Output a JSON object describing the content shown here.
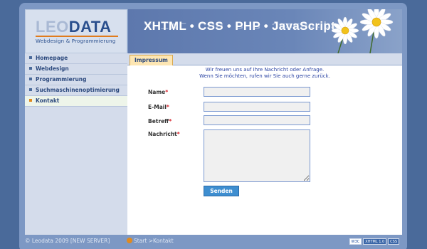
{
  "logo": {
    "leo": "LEO",
    "data": "DATA",
    "subtitle": "Webdesign & Programmierung"
  },
  "banner": {
    "title": "XHTML • CSS • PHP • JavaScript"
  },
  "sidebar": {
    "items": [
      {
        "label": "Homepage",
        "active": false
      },
      {
        "label": "Webdesign",
        "active": false
      },
      {
        "label": "Programmierung",
        "active": false
      },
      {
        "label": "Suchmaschinenoptimierung",
        "active": false
      },
      {
        "label": "Kontakt",
        "active": true
      }
    ]
  },
  "content": {
    "tab": "Impressum",
    "intro_line1": "Wir freuen uns auf Ihre Nachricht oder Anfrage.",
    "intro_line2": "Wenn Sie möchten, rufen wir Sie auch gerne zurück.",
    "form": {
      "name_label": "Name",
      "email_label": "E-Mail",
      "subject_label": "Betreff",
      "message_label": "Nachricht",
      "required_mark": "*",
      "name_value": "",
      "email_value": "",
      "subject_value": "",
      "message_value": "",
      "submit_label": "Senden"
    }
  },
  "footer": {
    "copyright": "© Leodata 2009 [NEW SERVER]",
    "breadcrumb": "Start >Kontakt",
    "badges": [
      "W3C",
      "XHTML 1.0",
      "CSS"
    ]
  },
  "colors": {
    "background": "#4a6a9a",
    "accent_orange": "#e08a1e",
    "nav_text": "#2d4a7e",
    "button": "#3e8ed0",
    "required": "#d8242c"
  }
}
